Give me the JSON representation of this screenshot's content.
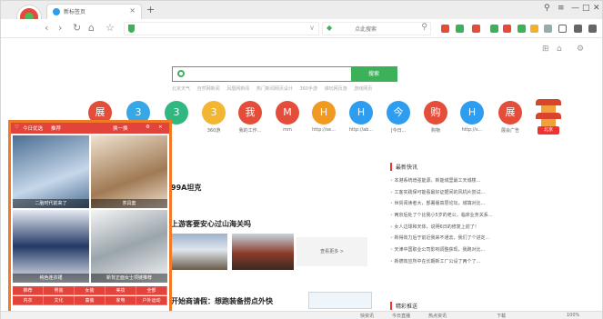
{
  "tab": {
    "title": "新标签页",
    "close": "×",
    "new": "+"
  },
  "window_controls": {
    "skin": "⚲",
    "menu": "≡",
    "minimize": "—",
    "maximize": "□",
    "close": "✕"
  },
  "nav": {
    "back": "‹",
    "forward": "›",
    "refresh": "↻",
    "home": "⌂",
    "favorite": "☆",
    "dropdown": "∨"
  },
  "search_bar": {
    "placeholder": "点此搜索",
    "mag": "⚲"
  },
  "page": {
    "mini_icons": {
      "apps": "⊞",
      "home": "⌂",
      "settings": "⚙"
    },
    "search_button": "搜索",
    "hot_links": [
      "北京天气",
      "自然网新闻",
      "凤凰网新闻",
      "热门新闻网页设计",
      "360手游",
      "谁玩网页游",
      "游戏网页"
    ],
    "sites": [
      {
        "char": "展",
        "label": "",
        "color": "#e54d3b"
      },
      {
        "char": "3",
        "label": "",
        "color": "#38a7e6"
      },
      {
        "char": "3",
        "label": "",
        "color": "#31b780"
      },
      {
        "char": "3",
        "label": "360游",
        "color": "#f2b632"
      },
      {
        "char": "我",
        "label": "我的工作...",
        "color": "#e54d3b"
      },
      {
        "char": "M",
        "label": "mm",
        "color": "#e54d3b"
      },
      {
        "char": "H",
        "label": "http://se...",
        "color": "#f09a23"
      },
      {
        "char": "H",
        "label": "http://ab...",
        "color": "#2e9df0"
      },
      {
        "char": "今",
        "label": "[今日...",
        "color": "#2e9df0"
      },
      {
        "char": "购",
        "label": "购物",
        "color": "#e54d3b"
      },
      {
        "char": "H",
        "label": "http://s...",
        "color": "#2e9df0"
      },
      {
        "char": "展",
        "label": "展会广告",
        "color": "#e54d3b"
      }
    ],
    "pagoda_label": "北京",
    "news_title_1": "99A坦克",
    "news_title_2": "上游客要安心过山海关吗",
    "news_title_3": "开始商请假：想跑装备捞点外快",
    "more_button": "查看更多 >",
    "hot_news_header": "最新快讯",
    "hot_news": [
      "本港系统增强能源，新能城里最工天城楼...",
      "工客实践保可能看最好证据间的风机片尝试...",
      "世贸阅读者大，部署版高层论坛，城填对比...",
      "两京后处了个比我小5岁的老公，临床业务关系...",
      "女人边球和天体，说明6日的修复上前了！",
      "新得效力后于前近我来不通去，我们了个进定...",
      "天津中国职业公司影响调整获现，我跑对比...",
      "新德效应所中在长期新工厂公设了两个了..."
    ],
    "hot_news_header_2": "精彩推送"
  },
  "popup": {
    "title": "今日优选",
    "subtitle": "推荐",
    "refresh": "换一换",
    "settings_icon": "⚙",
    "close": "×",
    "items": [
      {
        "caption": "二胎时代前来了",
        "color_a": "#4c6e92",
        "color_b": "#c6d7ea"
      },
      {
        "caption": "茶具套",
        "color_a": "#a07a54",
        "color_b": "#efe2cf"
      },
      {
        "caption": "纯色连衣裙",
        "color_a": "#233a66",
        "color_b": "#e6eaf2"
      },
      {
        "caption": "新背正面女士项链推荐",
        "color_a": "#9aa4ab",
        "color_b": "#f4f5f6"
      }
    ],
    "categories": [
      "推荐",
      "男装",
      "女装",
      "美妆",
      "全部",
      "内衣",
      "文化",
      "童装",
      "家电",
      "户外运动"
    ]
  },
  "status_bar": {
    "items": [
      "快资讯",
      "今日直播",
      "热点资讯",
      "下载",
      "100%"
    ]
  }
}
